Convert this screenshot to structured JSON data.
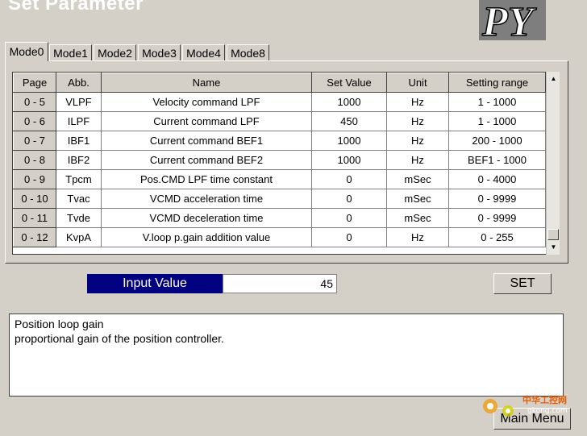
{
  "window": {
    "title": "Set Parameter"
  },
  "logo": {
    "text": "PY"
  },
  "tabs": [
    {
      "label": "Mode0",
      "active": true
    },
    {
      "label": "Mode1",
      "active": false
    },
    {
      "label": "Mode2",
      "active": false
    },
    {
      "label": "Mode3",
      "active": false
    },
    {
      "label": "Mode4",
      "active": false
    },
    {
      "label": "Mode8",
      "active": false
    }
  ],
  "table": {
    "headers": [
      "Page",
      "Abb.",
      "Name",
      "Set Value",
      "Unit",
      "Setting range"
    ],
    "rows": [
      [
        "0 - 5",
        "VLPF",
        "Velocity command LPF",
        "1000",
        "Hz",
        "1 - 1000"
      ],
      [
        "0 - 6",
        "ILPF",
        "Current command LPF",
        "450",
        "Hz",
        "1 - 1000"
      ],
      [
        "0 - 7",
        "IBF1",
        "Current command BEF1",
        "1000",
        "Hz",
        "200 - 1000"
      ],
      [
        "0 - 8",
        "IBF2",
        "Current command BEF2",
        "1000",
        "Hz",
        "BEF1 - 1000"
      ],
      [
        "0 - 9",
        "Tpcm",
        "Pos.CMD LPF time constant",
        "0",
        "mSec",
        "0 - 4000"
      ],
      [
        "0 - 10",
        "Tvac",
        "VCMD acceleration time",
        "0",
        "mSec",
        "0 - 9999"
      ],
      [
        "0 - 11",
        "Tvde",
        "VCMD deceleration time",
        "0",
        "mSec",
        "0 - 9999"
      ],
      [
        "0 - 12",
        "KvpA",
        "V.loop p.gain addition value",
        "0",
        "Hz",
        "0 - 255"
      ]
    ]
  },
  "input": {
    "label": "Input Value",
    "value": "45"
  },
  "buttons": {
    "set": "SET",
    "main_menu": "Main Menu"
  },
  "description": {
    "line1": "Position loop gain",
    "line2": "proportional gain of the position controller."
  },
  "watermark": {
    "text1": "中华工控网",
    "text2": "gkong.com"
  },
  "colors": {
    "background": "#d4d0c8",
    "input_label_bg": "#000080",
    "logo_bg": "#7e7e7e"
  }
}
